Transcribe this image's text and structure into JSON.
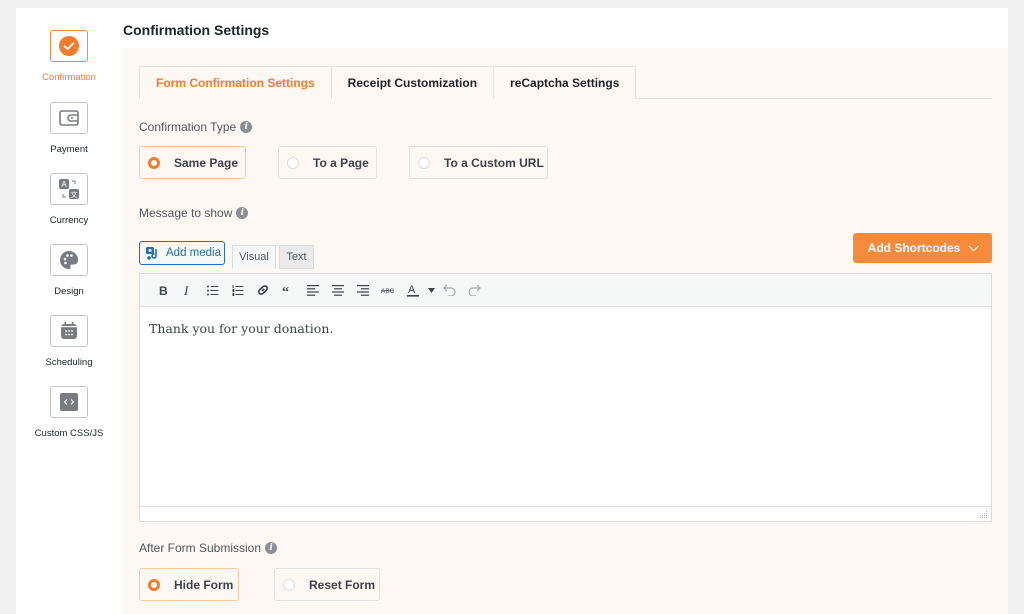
{
  "sidebar": {
    "items": [
      {
        "label": "Confirmation",
        "icon": "check-circle-icon",
        "active": true
      },
      {
        "label": "Payment",
        "icon": "wallet-icon",
        "active": false
      },
      {
        "label": "Currency",
        "icon": "translate-icon",
        "active": false
      },
      {
        "label": "Design",
        "icon": "palette-icon",
        "active": false
      },
      {
        "label": "Scheduling",
        "icon": "calendar-icon",
        "active": false
      },
      {
        "label": "Custom CSS/JS",
        "icon": "code-icon",
        "active": false
      }
    ]
  },
  "header": {
    "title": "Confirmation Settings"
  },
  "tabs": [
    {
      "label": "Form Confirmation Settings",
      "active": true
    },
    {
      "label": "Receipt Customization",
      "active": false
    },
    {
      "label": "reCaptcha Settings",
      "active": false
    }
  ],
  "confirmation_type": {
    "label": "Confirmation Type",
    "options": [
      {
        "label": "Same Page",
        "selected": true
      },
      {
        "label": "To a Page",
        "selected": false
      },
      {
        "label": "To a Custom URL",
        "selected": false
      }
    ]
  },
  "message": {
    "label": "Message to show",
    "add_media_label": "Add media",
    "visual_label": "Visual",
    "text_label": "Text",
    "shortcodes_label": "Add Shortcodes",
    "content": "Thank you for your donation.",
    "toolbar": [
      "bold",
      "italic",
      "bullet-list",
      "numbered-list",
      "link",
      "blockquote",
      "align-left",
      "align-center",
      "align-right",
      "strikethrough",
      "text-color",
      "text-color-dropdown",
      "undo",
      "redo"
    ]
  },
  "after_submission": {
    "label": "After Form Submission",
    "options": [
      {
        "label": "Hide Form",
        "selected": true
      },
      {
        "label": "Reset Form",
        "selected": false
      }
    ]
  },
  "colors": {
    "accent": "#f88a3c",
    "panel_bg": "#fef8f4",
    "link": "#2271b1"
  }
}
